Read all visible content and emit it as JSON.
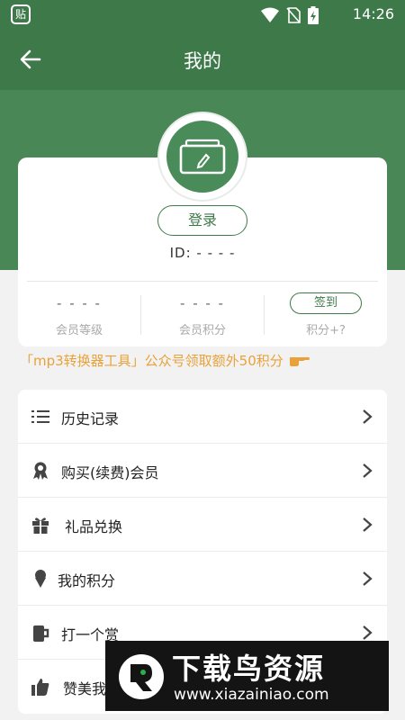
{
  "status_bar": {
    "app_badge": "贴",
    "time": "14:26"
  },
  "app_bar": {
    "title": "我的"
  },
  "profile": {
    "login_label": "登录",
    "id_text": "ID: - - - -",
    "stats": [
      {
        "value": "- - - -",
        "label": "会员等级"
      },
      {
        "value": "- - - -",
        "label": "会员积分"
      },
      {
        "button": "签到",
        "label": "积分+?"
      }
    ]
  },
  "promo_text": "「mp3转换器工具」公众号领取额外50积分",
  "menu": [
    {
      "label": "历史记录",
      "icon": "list-icon"
    },
    {
      "label": "购买(续费)会员",
      "icon": "badge-icon"
    },
    {
      "label": "礼品兑换",
      "icon": "gift-icon"
    },
    {
      "label": "我的积分",
      "icon": "ice-cream-icon"
    },
    {
      "label": "打一个赏",
      "icon": "beer-mug-icon"
    },
    {
      "label": "赞美我们",
      "icon": "thumbs-up-icon"
    }
  ],
  "watermark": {
    "title": "下载鸟资源",
    "url": "www.xiazainiao.com"
  },
  "colors": {
    "primary": "#3e7a49",
    "header": "#4a8757",
    "promo": "#e9a23a"
  }
}
